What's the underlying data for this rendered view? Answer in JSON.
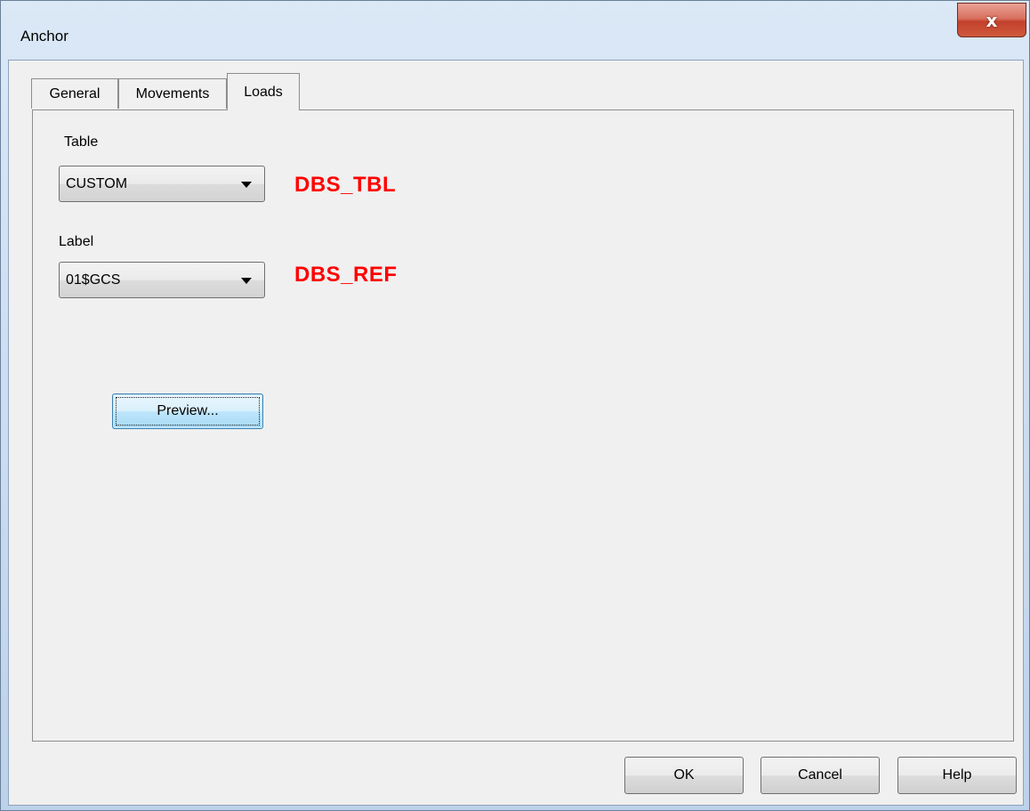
{
  "window": {
    "title": "Anchor",
    "close_glyph": "x"
  },
  "tabs": [
    {
      "label": "General",
      "active": false
    },
    {
      "label": "Movements",
      "active": false
    },
    {
      "label": "Loads",
      "active": true
    }
  ],
  "loads": {
    "table_label": "Table",
    "table_value": "CUSTOM",
    "table_tag": "DBS_TBL",
    "label_label": "Label",
    "label_value": "01$GCS",
    "label_tag": "DBS_REF",
    "preview_button": "Preview..."
  },
  "footer": {
    "ok": "OK",
    "cancel": "Cancel",
    "help": "Help"
  },
  "colors": {
    "tag_red": "#ff0000",
    "close_red": "#c2402c"
  }
}
